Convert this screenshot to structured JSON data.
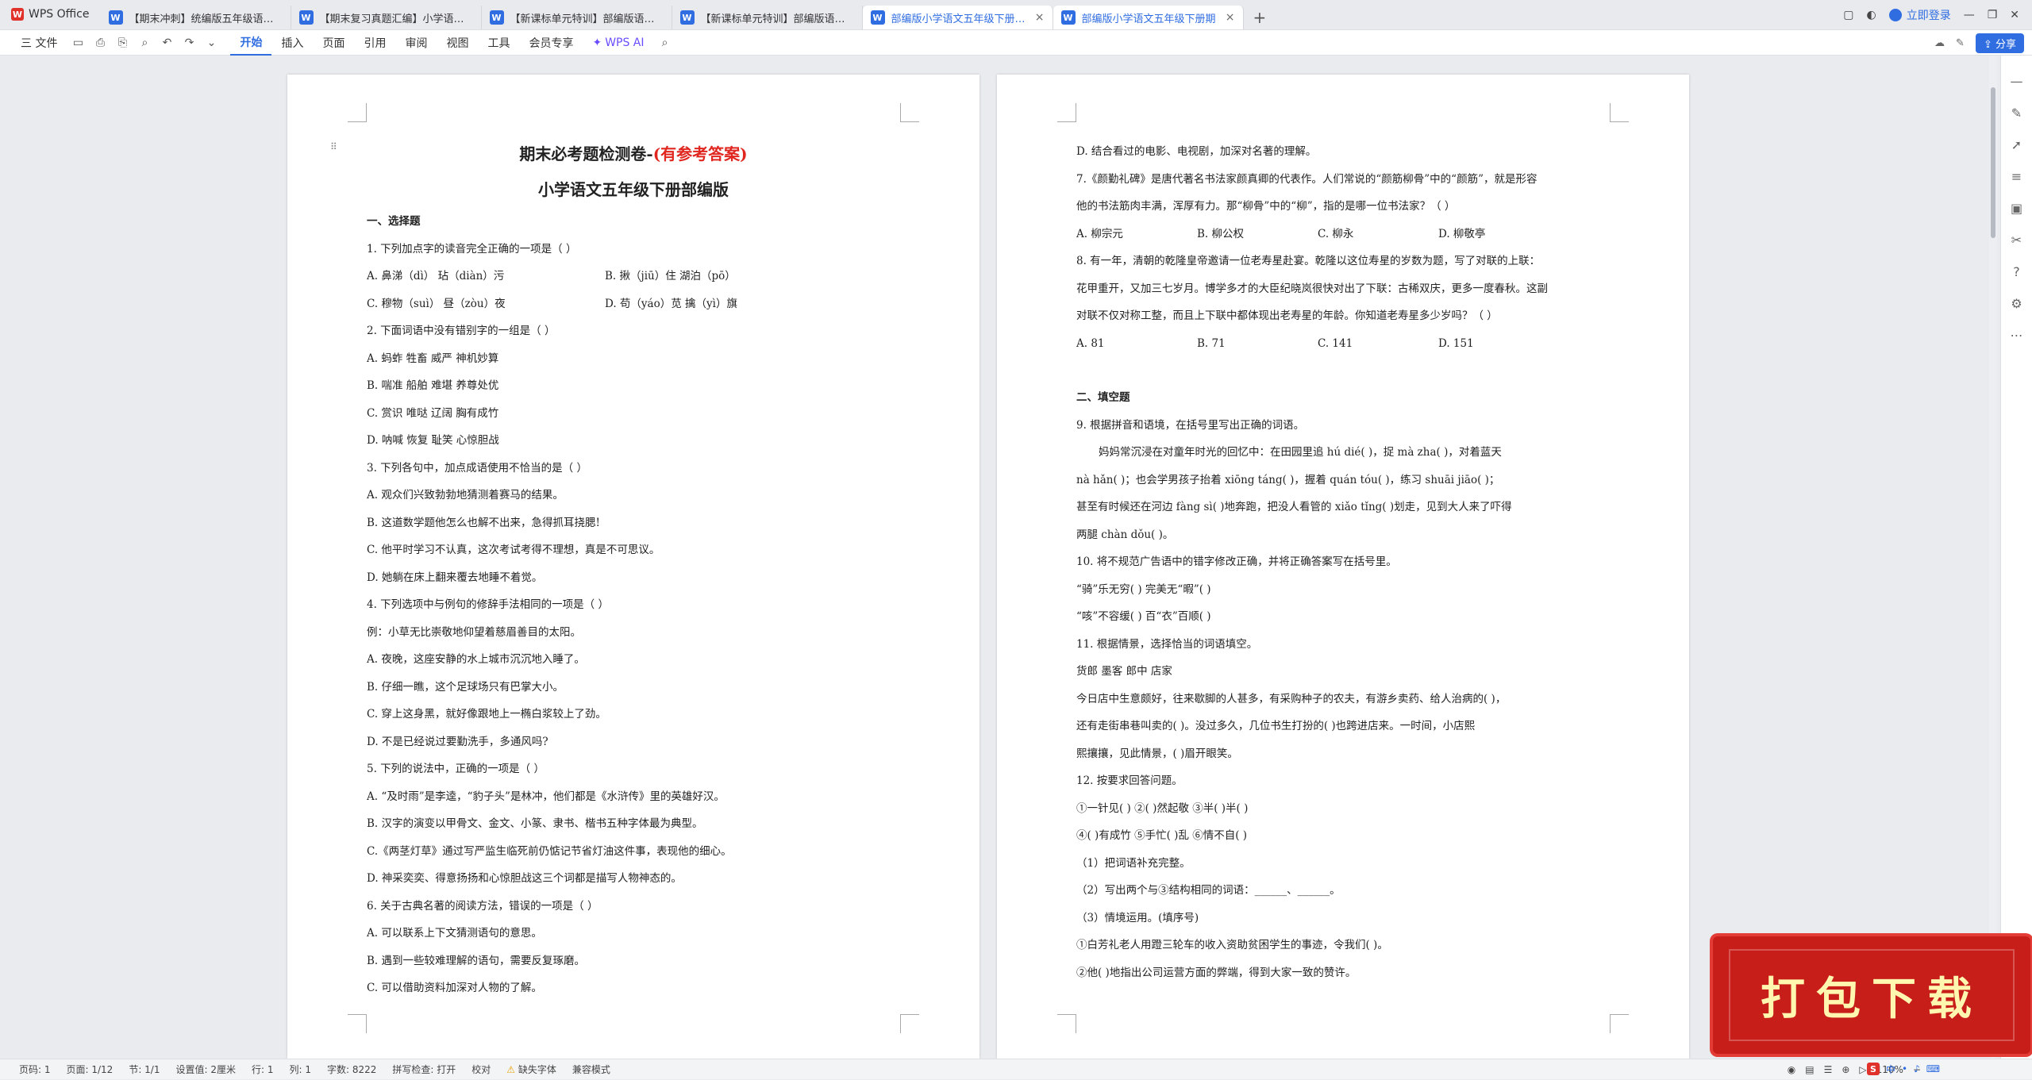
{
  "app": {
    "name": "WPS Office",
    "badge": "W"
  },
  "tabs": [
    {
      "label": "【期末冲刺】统编版五年级语文下册",
      "close": ""
    },
    {
      "label": "【期末复习真题汇编】小学语文五年",
      "close": ""
    },
    {
      "label": "【新课标单元特训】部编版语文五年",
      "close": ""
    },
    {
      "label": "【新课标单元特训】部编版语文五年",
      "close": ""
    },
    {
      "label": "部编版小学语文五年级下册期末按",
      "close": "×"
    },
    {
      "label": "部编版小学语文五年级下册期",
      "close": "×"
    }
  ],
  "tab_icon": "W",
  "tab_add": "+",
  "titlebar": {
    "login": "立即登录"
  },
  "ribbon": {
    "file": "三 文件",
    "items": [
      "开始",
      "插入",
      "页面",
      "引用",
      "审阅",
      "视图",
      "工具",
      "会员专享"
    ],
    "ai": "WPS AI",
    "share": "分享"
  },
  "page1": {
    "title_black": "期末必考题检测卷-",
    "title_red": "(有参考答案)",
    "subtitle": "小学语文五年级下册部编版",
    "lines": [
      {
        "t": "一、选择题",
        "cls": "sec"
      },
      {
        "t": "1. 下列加点字的读音完全正确的一项是（    ）"
      },
      {
        "opts2": [
          "A. 鼻涕（dì）   玷（diàn）污",
          "B. 揪（jiū）住    湖泊（pō）"
        ]
      },
      {
        "opts2": [
          "C. 穆物（suì）   昼（zòu）夜",
          "D. 苟（yáo）苋    擒（yì）旗"
        ]
      },
      {
        "t": "2. 下面词语中没有错别字的一组是（    ）"
      },
      {
        "t": "A. 蚂蚱   牲畜   威严   神机妙算"
      },
      {
        "t": "B. 喘准   船舶   难堪   养尊处优"
      },
      {
        "t": "C. 赏识   唯哒   辽阔   胸有成竹"
      },
      {
        "t": "D. 呐喊   恢复   耻笑   心惊胆战"
      },
      {
        "t": "3. 下列各句中，加点成语使用不恰当的是（    ）"
      },
      {
        "t": "A. 观众们兴致勃勃地猜测着赛马的结果。"
      },
      {
        "t": "B. 这道数学题他怎么也解不出来，急得抓耳挠腮!"
      },
      {
        "t": "C. 他平时学习不认真，这次考试考得不理想，真是不可思议。"
      },
      {
        "t": "D. 她躺在床上翻来覆去地睡不着觉。"
      },
      {
        "t": "4. 下列选项中与例句的修辞手法相同的一项是（    ）"
      },
      {
        "t": "例：小草无比崇敬地仰望着慈眉善目的太阳。"
      },
      {
        "t": "A. 夜晚，这座安静的水上城市沉沉地入睡了。"
      },
      {
        "t": "B. 仔细一瞧，这个足球场只有巴掌大小。"
      },
      {
        "t": "C. 穿上这身黑，就好像跟地上一椭白浆较上了劲。"
      },
      {
        "t": "D. 不是已经说过要勤洗手，多通风吗?"
      },
      {
        "t": "5. 下列的说法中，正确的一项是（    ）"
      },
      {
        "t": "A. “及时雨”是李逵，“豹子头”是林冲，他们都是《水浒传》里的英雄好汉。"
      },
      {
        "t": "B. 汉字的演变以甲骨文、金文、小篆、隶书、楷书五种字体最为典型。"
      },
      {
        "t": "C.《两茎灯草》通过写严监生临死前仍惦记节省灯油这件事，表现他的细心。"
      },
      {
        "t": "D. 神采奕奕、得意扬扬和心惊胆战这三个词都是描写人物神态的。"
      },
      {
        "t": "6. 关于古典名著的阅读方法，错误的一项是（    ）"
      },
      {
        "t": "A. 可以联系上下文猜测语句的意思。"
      },
      {
        "t": "B. 遇到一些较难理解的语句，需要反复琢磨。"
      },
      {
        "t": "C. 可以借助资料加深对人物的了解。"
      }
    ]
  },
  "page2": {
    "lines": [
      {
        "t": "D. 结合看过的电影、电视剧，加深对名著的理解。"
      },
      {
        "t": "7.《颜勤礼碑》是唐代著名书法家颜真卿的代表作。人们常说的“颜筋柳骨”中的“颜筋”，就是形容"
      },
      {
        "t": "他的书法筋肉丰满，浑厚有力。那“柳骨”中的“柳”，指的是哪一位书法家？（    ）"
      },
      {
        "opts": [
          "A. 柳宗元",
          "B. 柳公权",
          "C. 柳永",
          "D. 柳敬亭"
        ]
      },
      {
        "t": "8. 有一年，清朝的乾隆皇帝邀请一位老寿星赴宴。乾隆以这位寿星的岁数为题，写了对联的上联："
      },
      {
        "t": "花甲重开，又加三七岁月。博学多才的大臣纪晓岚很快对出了下联：古稀双庆，更多一度春秋。这副"
      },
      {
        "t": "对联不仅对称工整，而且上下联中都体现出老寿星的年龄。你知道老寿星多少岁吗？（    ）"
      },
      {
        "opts": [
          "A. 81",
          "B. 71",
          "C. 141",
          "D. 151"
        ]
      },
      {
        "gap": true
      },
      {
        "t": "二、填空题",
        "cls": "sec"
      },
      {
        "t": "9. 根据拼音和语境，在括号里写出正确的词语。"
      },
      {
        "t": "妈妈常沉浸在对童年时光的回忆中：在田园里追 hú dié(        )，捉 mà zha(        )，对着蓝天",
        "cls": "ind"
      },
      {
        "t": "nà hǎn(        )；也会学男孩子抬着 xiōng táng(        )，握着 quán tóu(        )，练习 shuāi jiāo(        )；"
      },
      {
        "t": "甚至有时候还在河边 fàng sì(        )地奔跑，把没人看管的 xiǎo tǐng(        )划走，见到大人来了吓得"
      },
      {
        "t": "两腿 chàn dǒu(        )。"
      },
      {
        "t": "10. 将不规范广告语中的错字修改正确，并将正确答案写在括号里。"
      },
      {
        "t": "“骑”乐无穷(          )      完美无“暇”(          )"
      },
      {
        "t": "“咳”不容缓(          )      百“衣”百顺(          )"
      },
      {
        "t": "11. 根据情景，选择恰当的词语填空。"
      },
      {
        "t": "货郎      墨客      郎中      店家"
      },
      {
        "t": "今日店中生意颇好，往来歇脚的人甚多，有采购种子的农夫，有游乡卖药、给人治病的(          )，"
      },
      {
        "t": "还有走街串巷叫卖的(          )。没过多久，几位书生打扮的(          )也跨进店来。一时间，小店熙"
      },
      {
        "t": "熙攘攘，见此情景，(          )眉开眼笑。"
      },
      {
        "t": "12. 按要求回答问题。"
      },
      {
        "t": "①一针见(      )      ②(      )然起敬      ③半(      )半(      )"
      },
      {
        "t": "④(      )有成竹      ⑤手忙(      )乱      ⑥情不自(      )"
      },
      {
        "t": "（1）把词语补充完整。"
      },
      {
        "t": "（2）写出两个与③结构相同的词语：______、______。"
      },
      {
        "t": "（3）情境运用。(填序号)"
      },
      {
        "t": "①白芳礼老人用蹬三轮车的收入资助贫困学生的事迹，令我们(      )。"
      },
      {
        "t": "②他(      )地指出公司运营方面的弊端，得到大家一致的赞许。"
      }
    ]
  },
  "status": {
    "page": "页码: 1",
    "pages": "页面: 1/12",
    "section": "节: 1/1",
    "setting": "设置值: 2厘米",
    "row": "行: 1",
    "col": "列: 1",
    "words": "字数: 8222",
    "spell": "拼写检查: 打开",
    "proof": "校对",
    "missing_font": "缺失字体",
    "compat": "兼容模式",
    "zoom": "110%"
  },
  "promo": {
    "text": "打包下载"
  },
  "ime": {
    "lang": "中"
  },
  "colors": {
    "accent": "#2f6de1",
    "red": "#e0261f",
    "promo": "#c81e1a"
  }
}
